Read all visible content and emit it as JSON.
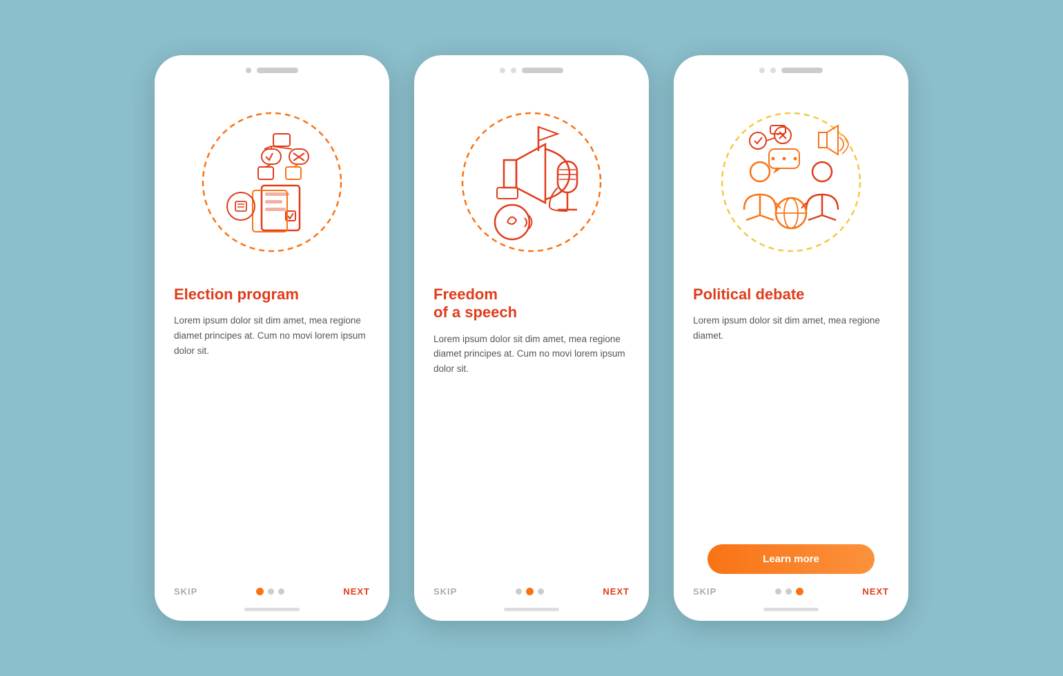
{
  "background": "#8bbfcc",
  "phones": [
    {
      "id": "election-program",
      "title": "Election program",
      "title_color": "#e03c1b",
      "body": "Lorem ipsum dolor sit dim amet, mea regione diamet principes at. Cum no movi lorem ipsum dolor sit.",
      "dots": [
        true,
        false,
        false
      ],
      "skip_label": "SKIP",
      "next_label": "NEXT",
      "has_button": false,
      "illustration_type": "election",
      "dashed_color": "#f97316",
      "dot1_active": true,
      "dot2_active": false,
      "dot3_active": false
    },
    {
      "id": "freedom-of-speech",
      "title": "Freedom\nof a speech",
      "title_color": "#e03c1b",
      "body": "Lorem ipsum dolor sit dim amet, mea regione diamet principes at. Cum no movi lorem ipsum dolor sit.",
      "dots": [
        false,
        true,
        false
      ],
      "skip_label": "SKIP",
      "next_label": "NEXT",
      "has_button": false,
      "illustration_type": "speech",
      "dashed_color": "#f97316",
      "dot1_active": false,
      "dot2_active": true,
      "dot3_active": false
    },
    {
      "id": "political-debate",
      "title": "Political debate",
      "title_color": "#e03c1b",
      "body": "Lorem ipsum dolor sit dim amet, mea regione diamet.",
      "dots": [
        false,
        false,
        true
      ],
      "skip_label": "SKIP",
      "next_label": "NEXT",
      "has_button": true,
      "button_label": "Learn more",
      "illustration_type": "debate",
      "dashed_color": "#f5c842",
      "dot1_active": false,
      "dot2_active": false,
      "dot3_active": true
    }
  ]
}
